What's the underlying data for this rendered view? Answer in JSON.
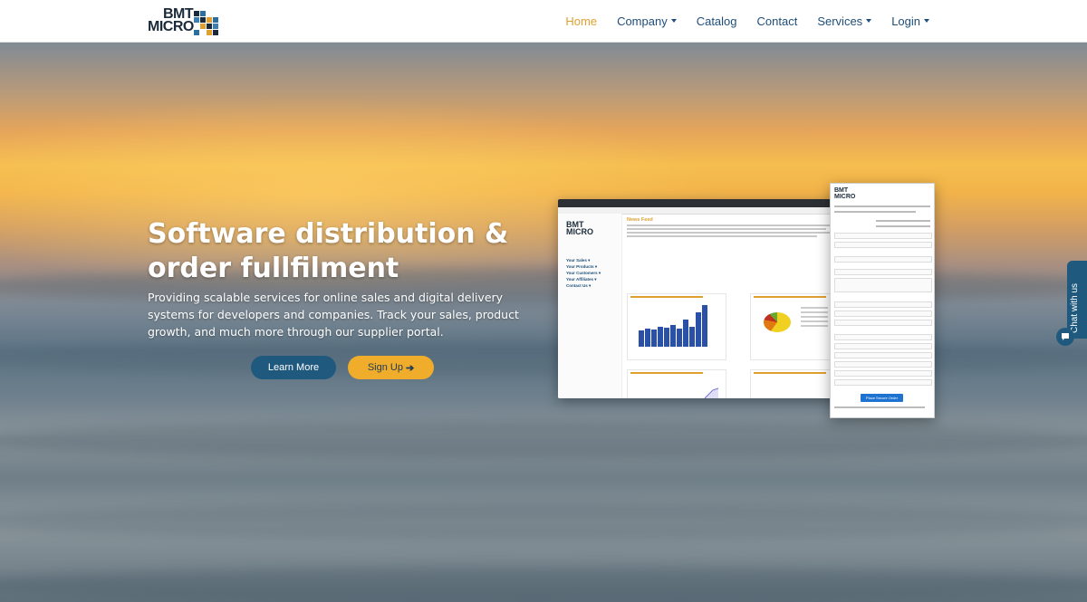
{
  "brand": {
    "line1": "BMT",
    "line2": "MICRO"
  },
  "nav": {
    "items": [
      {
        "label": "Home",
        "active": true,
        "dropdown": false
      },
      {
        "label": "Company",
        "active": false,
        "dropdown": true
      },
      {
        "label": "Catalog",
        "active": false,
        "dropdown": false
      },
      {
        "label": "Contact",
        "active": false,
        "dropdown": false
      },
      {
        "label": "Services",
        "active": false,
        "dropdown": true
      },
      {
        "label": "Login",
        "active": false,
        "dropdown": true
      }
    ]
  },
  "hero": {
    "title": "Software distribution & order fullfilment",
    "description": "Providing scalable services for online sales and digital delivery systems for developers and companies. Track your sales, product growth, and much more through our supplier portal.",
    "learn_more_label": "Learn More",
    "signup_label": "Sign Up",
    "signup_icon": "arrow-right-icon"
  },
  "dashboard": {
    "logo_line1": "BMT",
    "logo_line2": "MICRO",
    "feed_title": "News Feed",
    "menu": [
      "Your Sales ▾",
      "Your Products ▾",
      "Your Customers ▾",
      "Your Affiliates ▾",
      "Contact Us ▾"
    ]
  },
  "checkout": {
    "logo_line1": "BMT",
    "logo_line2": "MICRO",
    "button_label": "Place Secure Order"
  },
  "chat": {
    "label": "Chat with us",
    "icon": "chat-bubble-icon"
  },
  "colors": {
    "nav_link": "#1e4e79",
    "nav_active": "#e0a030",
    "learn_more_bg": "#1f5a7e",
    "signup_bg": "#f0ad2b"
  }
}
